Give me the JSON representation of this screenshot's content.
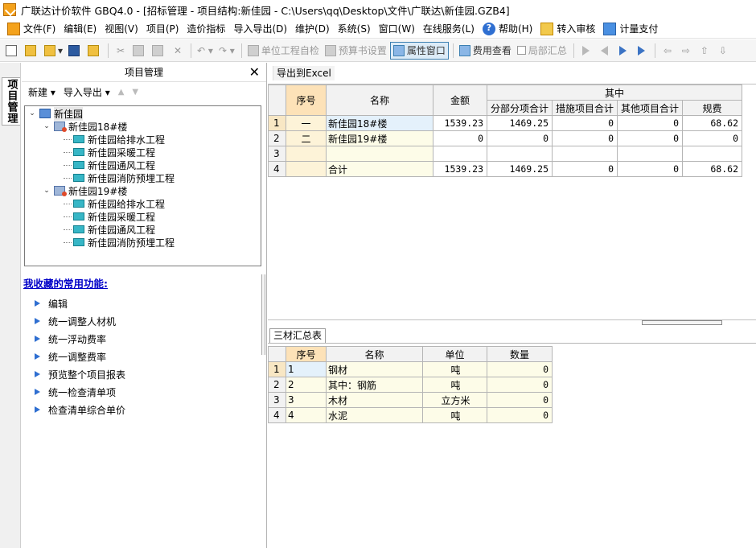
{
  "window": {
    "title": "广联达计价软件 GBQ4.0 - [招标管理 - 项目结构:新佳园 - C:\\Users\\qq\\Desktop\\文件\\广联达\\新佳园.GZB4]"
  },
  "menubar": {
    "items": [
      "文件(F)",
      "编辑(E)",
      "视图(V)",
      "项目(P)",
      "造价指标",
      "导入导出(D)",
      "维护(D)",
      "系统(S)",
      "窗口(W)",
      "在线服务(L)"
    ],
    "help": "帮助(H)",
    "review": "转入审核",
    "pay": "计量支付"
  },
  "toolbar": {
    "self_check": "单位工程自检",
    "budget_settings": "预算书设置",
    "property_window": "属性窗口",
    "fee_view": "费用查看",
    "partial_summary": "局部汇总"
  },
  "left_tab": {
    "label": "项目管理"
  },
  "left_panel": {
    "title": "项目管理",
    "new_label": "新建",
    "import_export_label": "导入导出",
    "tree": {
      "root": "新佳园",
      "buildings": [
        {
          "name": "新佳园18#楼",
          "units": [
            "新佳园给排水工程",
            "新佳园采暖工程",
            "新佳园通风工程",
            "新佳园消防预埋工程"
          ]
        },
        {
          "name": "新佳园19#楼",
          "units": [
            "新佳园给排水工程",
            "新佳园采暖工程",
            "新佳园通风工程",
            "新佳园消防预埋工程"
          ]
        }
      ]
    },
    "favorites_title": "我收藏的常用功能:",
    "favorites": [
      "编辑",
      "统一调整人材机",
      "统一浮动费率",
      "统一调整费率",
      "预览整个项目报表",
      "统一检查清单项",
      "检查清单综合单价"
    ]
  },
  "right_panel": {
    "export_label": "导出到Excel",
    "main_table": {
      "group_header": "其中",
      "headers": [
        "序号",
        "名称",
        "金额",
        "分部分项合计",
        "措施项目合计",
        "其他项目合计",
        "规费"
      ],
      "rows": [
        {
          "rownum": "1",
          "seq": "一",
          "name": "新佳园18#楼",
          "amount": "1539.23",
          "fbfx": "1469.25",
          "csxm": "0",
          "qtxm": "0",
          "gf": "68.62"
        },
        {
          "rownum": "2",
          "seq": "二",
          "name": "新佳园19#楼",
          "amount": "0",
          "fbfx": "0",
          "csxm": "0",
          "qtxm": "0",
          "gf": "0"
        },
        {
          "rownum": "3",
          "seq": "",
          "name": "",
          "amount": "",
          "fbfx": "",
          "csxm": "",
          "qtxm": "",
          "gf": ""
        },
        {
          "rownum": "4",
          "seq": "",
          "name": "合计",
          "amount": "1539.23",
          "fbfx": "1469.25",
          "csxm": "0",
          "qtxm": "0",
          "gf": "68.62"
        }
      ]
    },
    "bottom_tab": "三材汇总表",
    "material_table": {
      "headers": [
        "序号",
        "名称",
        "单位",
        "数量"
      ],
      "rows": [
        {
          "rownum": "1",
          "seq": "1",
          "name": "钢材",
          "unit": "吨",
          "qty": "0"
        },
        {
          "rownum": "2",
          "seq": "2",
          "name": "其中：钢筋",
          "unit": "吨",
          "qty": "0"
        },
        {
          "rownum": "3",
          "seq": "3",
          "name": "木材",
          "unit": "立方米",
          "qty": "0"
        },
        {
          "rownum": "4",
          "seq": "4",
          "name": "水泥",
          "unit": "吨",
          "qty": "0"
        }
      ]
    }
  }
}
